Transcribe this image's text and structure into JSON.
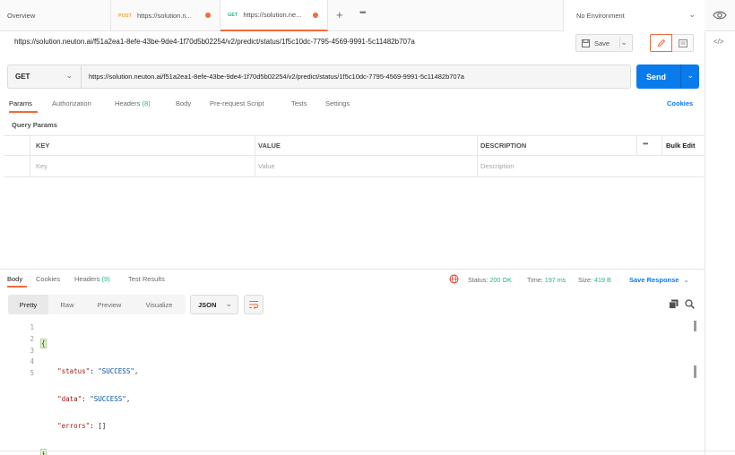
{
  "tabs": [
    {
      "label": "Overview",
      "method": ""
    },
    {
      "label": "https://solution.n...",
      "method": "POST",
      "method_color": "#f1a537"
    },
    {
      "label": "https://solution.ne...",
      "method": "GET",
      "method_color": "#26b47f"
    }
  ],
  "environment": {
    "label": "No Environment"
  },
  "request": {
    "title": "https://solution.neuton.ai/f51a2ea1-8efe-43be-9de4-1f70d5b02254/v2/predict/status/1f5c10dc-7795-4569-9991-5c11482b707a",
    "save_label": "Save",
    "method": "GET",
    "url": "https://solution.neuton.ai/f51a2ea1-8efe-43be-9de4-1f70d5b02254/v2/predict/status/1f5c10dc-7795-4569-9991-5c11482b707a",
    "send_label": "Send"
  },
  "req_tabs": {
    "params": "Params",
    "authorization": "Authorization",
    "headers": "Headers",
    "headers_count": "(8)",
    "body": "Body",
    "prerequest": "Pre-request Script",
    "tests": "Tests",
    "settings": "Settings",
    "cookies": "Cookies"
  },
  "query_params": {
    "label": "Query Params",
    "columns": [
      "KEY",
      "VALUE",
      "DESCRIPTION"
    ],
    "bulk_edit": "Bulk Edit",
    "placeholders": [
      "Key",
      "Value",
      "Description"
    ]
  },
  "response": {
    "tabs": {
      "body": "Body",
      "cookies": "Cookies",
      "headers": "Headers",
      "headers_count": "(9)",
      "test_results": "Test Results"
    },
    "status_label": "Status:",
    "status_value": "200 OK",
    "time_label": "Time:",
    "time_value": "197 ms",
    "size_label": "Size:",
    "size_value": "419 B",
    "save_response": "Save Response",
    "views": [
      "Pretty",
      "Raw",
      "Preview",
      "Visualize"
    ],
    "format": "JSON",
    "lines": [
      "1",
      "2",
      "3",
      "4",
      "5"
    ],
    "code": {
      "open": "{",
      "k1": "\"status\"",
      "v1": "\"SUCCESS\"",
      "k2": "\"data\"",
      "v2": "\"SUCCESS\"",
      "k3": "\"errors\"",
      "v3": "[]",
      "close": "}"
    }
  },
  "colors": {
    "accent": "#f26b3a",
    "primary": "#097bed",
    "success": "#26b47f"
  }
}
